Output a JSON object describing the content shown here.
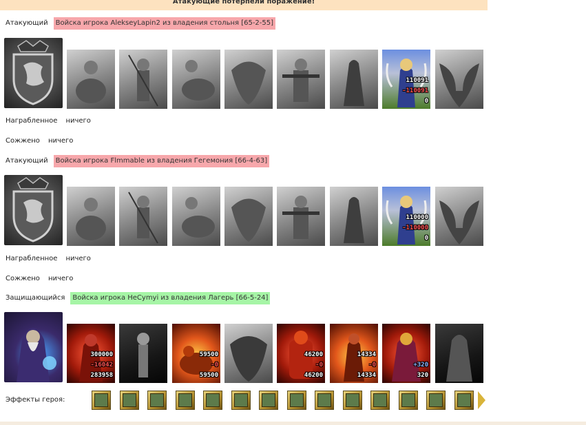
{
  "banner": "Атакующие потерпели поражение!",
  "sections": [
    {
      "side_label": "Атакующий",
      "army": "Войска игрока AlekseyLapin2 из владения стольня [65-2-55]",
      "looted_label": "Награбленное",
      "looted_value": "ничего",
      "burned_label": "Сожжено",
      "burned_value": "ничего",
      "units": [
        {
          "icon": "rider-unit-icon"
        },
        {
          "icon": "pikeman-unit-icon"
        },
        {
          "icon": "cavalry-unit-icon"
        },
        {
          "icon": "griffin-unit-icon"
        },
        {
          "icon": "crossbowman-unit-icon"
        },
        {
          "icon": "monk-unit-icon"
        },
        {
          "icon": "paladin-unit-icon",
          "count": "110091",
          "loss": "-110091",
          "left": "0"
        },
        {
          "icon": "angel-unit-icon"
        }
      ]
    },
    {
      "side_label": "Атакующий",
      "army": "Войска игрока Flmmable из владения Гегемония [66-4-63]",
      "looted_label": "Награбленное",
      "looted_value": "ничего",
      "burned_label": "Сожжено",
      "burned_value": "ничего",
      "units": [
        {
          "icon": "rider-unit-icon"
        },
        {
          "icon": "pikeman-unit-icon"
        },
        {
          "icon": "cavalry-unit-icon"
        },
        {
          "icon": "griffin-unit-icon"
        },
        {
          "icon": "crossbowman-unit-icon"
        },
        {
          "icon": "monk-unit-icon"
        },
        {
          "icon": "paladin-unit-icon",
          "count": "110000",
          "loss": "-110000",
          "left": "0"
        },
        {
          "icon": "angel-unit-icon"
        }
      ]
    },
    {
      "side_label": "Защищающийся",
      "army": "Войска игрока HeCymyi из владения Лагерь [66-5-24]",
      "units": [
        {
          "icon": "demon-unit-icon",
          "count": "300000",
          "loss": "-16042",
          "left": "283958"
        },
        {
          "icon": "skeleton-unit-icon"
        },
        {
          "icon": "hellhound-unit-icon",
          "count": "59500",
          "loss": "-0",
          "left": "59500"
        },
        {
          "icon": "dragon-unit-icon"
        },
        {
          "icon": "fire-golem-unit-icon",
          "count": "46200",
          "loss": "-0",
          "left": "46200"
        },
        {
          "icon": "fire-warrior-unit-icon",
          "count": "14334",
          "loss": "-0",
          "left": "14334"
        },
        {
          "icon": "demon-lord-unit-icon",
          "count": "0",
          "gain": "+320",
          "left": "320"
        },
        {
          "icon": "wraith-unit-icon"
        }
      ]
    }
  ],
  "effects_label": "Эффекты героя:",
  "effects": [
    "mask-icon",
    "mask-eye-icon",
    "arrows-icon",
    "blue-orb-icon",
    "gold-crest-icon",
    "web-icon",
    "armor-icon",
    "crossed-arrows-icon",
    "scroll-icon",
    "bow-icon",
    "cage-icon",
    "warrior-icon",
    "shield-sword-icon",
    "heart-icon"
  ],
  "colors": {
    "banner_bg": "#fde2bf",
    "attacker_tag": "#f7a7ab",
    "defender_tag": "#a6f5a6",
    "loss_text": "#ff5555",
    "gain_text": "#8fb6ff"
  }
}
